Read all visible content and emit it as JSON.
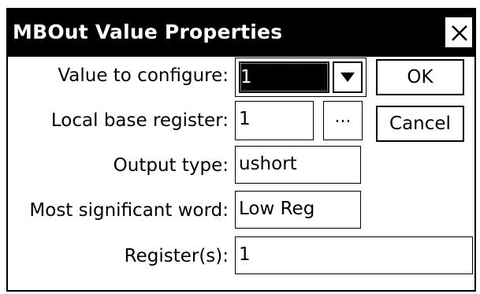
{
  "dialog": {
    "title": "MBOut Value Properties",
    "close_icon": "close-icon"
  },
  "form": {
    "value_to_configure": {
      "label": "Value to configure:",
      "value": "1"
    },
    "local_base_register": {
      "label": "Local base register:",
      "value": "1",
      "browse_label": "..."
    },
    "output_type": {
      "label": "Output type:",
      "value": "ushort"
    },
    "most_significant_word": {
      "label": "Most significant word:",
      "value": "Low Reg"
    },
    "registers": {
      "label": "Register(s):",
      "value": "1"
    }
  },
  "buttons": {
    "ok_label": "OK",
    "cancel_label": "Cancel"
  },
  "icons": {
    "dropdown": "triangle-down-icon"
  }
}
